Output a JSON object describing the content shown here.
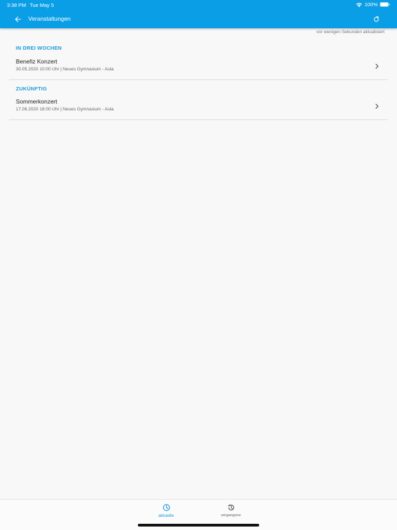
{
  "status": {
    "time": "3:38 PM",
    "date": "Tue May 5",
    "battery": "100%"
  },
  "nav": {
    "title": "Veranstaltungen",
    "back_icon": "arrow-left-icon",
    "refresh_icon": "refresh-icon"
  },
  "updated_note": "vor wenigen Sekunden aktualisiert",
  "sections": [
    {
      "header": "IN DREI WOCHEN",
      "events": [
        {
          "title": "Benefiz Konzert",
          "subtitle": "30.05.2020 10:00 Uhr | Neues Gymnasium - Aula"
        }
      ]
    },
    {
      "header": "ZUKÜNFTIG",
      "events": [
        {
          "title": "Sommerkonzert",
          "subtitle": "17.06.2020 18:00 Uhr | Neues Gymnasium - Aula"
        }
      ]
    }
  ],
  "tabs": [
    {
      "label": "aktuelle",
      "icon": "clock-icon",
      "active": true
    },
    {
      "label": "vergangene",
      "icon": "history-icon",
      "active": false
    }
  ],
  "colors": {
    "accent": "#0a9ee6",
    "section_header": "#1b9ad9",
    "background": "#f8f8f8"
  }
}
